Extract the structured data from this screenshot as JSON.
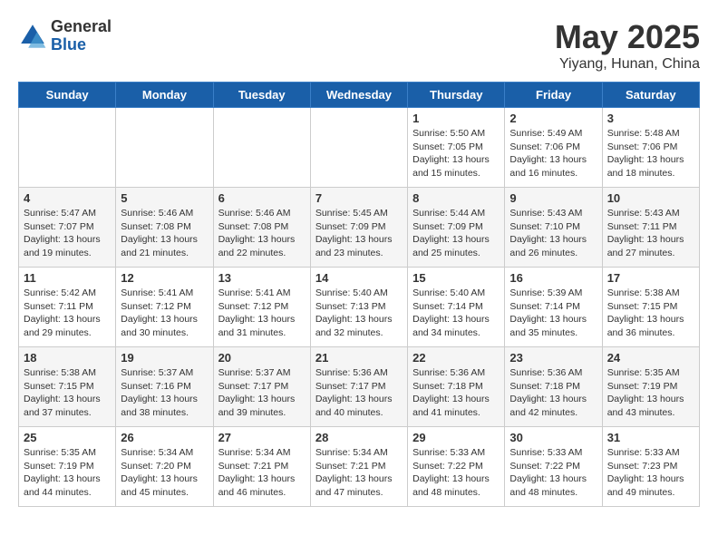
{
  "logo": {
    "general": "General",
    "blue": "Blue"
  },
  "title": "May 2025",
  "location": "Yiyang, Hunan, China",
  "days_of_week": [
    "Sunday",
    "Monday",
    "Tuesday",
    "Wednesday",
    "Thursday",
    "Friday",
    "Saturday"
  ],
  "weeks": [
    [
      {
        "day": "",
        "info": ""
      },
      {
        "day": "",
        "info": ""
      },
      {
        "day": "",
        "info": ""
      },
      {
        "day": "",
        "info": ""
      },
      {
        "day": "1",
        "info": "Sunrise: 5:50 AM\nSunset: 7:05 PM\nDaylight: 13 hours\nand 15 minutes."
      },
      {
        "day": "2",
        "info": "Sunrise: 5:49 AM\nSunset: 7:06 PM\nDaylight: 13 hours\nand 16 minutes."
      },
      {
        "day": "3",
        "info": "Sunrise: 5:48 AM\nSunset: 7:06 PM\nDaylight: 13 hours\nand 18 minutes."
      }
    ],
    [
      {
        "day": "4",
        "info": "Sunrise: 5:47 AM\nSunset: 7:07 PM\nDaylight: 13 hours\nand 19 minutes."
      },
      {
        "day": "5",
        "info": "Sunrise: 5:46 AM\nSunset: 7:08 PM\nDaylight: 13 hours\nand 21 minutes."
      },
      {
        "day": "6",
        "info": "Sunrise: 5:46 AM\nSunset: 7:08 PM\nDaylight: 13 hours\nand 22 minutes."
      },
      {
        "day": "7",
        "info": "Sunrise: 5:45 AM\nSunset: 7:09 PM\nDaylight: 13 hours\nand 23 minutes."
      },
      {
        "day": "8",
        "info": "Sunrise: 5:44 AM\nSunset: 7:09 PM\nDaylight: 13 hours\nand 25 minutes."
      },
      {
        "day": "9",
        "info": "Sunrise: 5:43 AM\nSunset: 7:10 PM\nDaylight: 13 hours\nand 26 minutes."
      },
      {
        "day": "10",
        "info": "Sunrise: 5:43 AM\nSunset: 7:11 PM\nDaylight: 13 hours\nand 27 minutes."
      }
    ],
    [
      {
        "day": "11",
        "info": "Sunrise: 5:42 AM\nSunset: 7:11 PM\nDaylight: 13 hours\nand 29 minutes."
      },
      {
        "day": "12",
        "info": "Sunrise: 5:41 AM\nSunset: 7:12 PM\nDaylight: 13 hours\nand 30 minutes."
      },
      {
        "day": "13",
        "info": "Sunrise: 5:41 AM\nSunset: 7:12 PM\nDaylight: 13 hours\nand 31 minutes."
      },
      {
        "day": "14",
        "info": "Sunrise: 5:40 AM\nSunset: 7:13 PM\nDaylight: 13 hours\nand 32 minutes."
      },
      {
        "day": "15",
        "info": "Sunrise: 5:40 AM\nSunset: 7:14 PM\nDaylight: 13 hours\nand 34 minutes."
      },
      {
        "day": "16",
        "info": "Sunrise: 5:39 AM\nSunset: 7:14 PM\nDaylight: 13 hours\nand 35 minutes."
      },
      {
        "day": "17",
        "info": "Sunrise: 5:38 AM\nSunset: 7:15 PM\nDaylight: 13 hours\nand 36 minutes."
      }
    ],
    [
      {
        "day": "18",
        "info": "Sunrise: 5:38 AM\nSunset: 7:15 PM\nDaylight: 13 hours\nand 37 minutes."
      },
      {
        "day": "19",
        "info": "Sunrise: 5:37 AM\nSunset: 7:16 PM\nDaylight: 13 hours\nand 38 minutes."
      },
      {
        "day": "20",
        "info": "Sunrise: 5:37 AM\nSunset: 7:17 PM\nDaylight: 13 hours\nand 39 minutes."
      },
      {
        "day": "21",
        "info": "Sunrise: 5:36 AM\nSunset: 7:17 PM\nDaylight: 13 hours\nand 40 minutes."
      },
      {
        "day": "22",
        "info": "Sunrise: 5:36 AM\nSunset: 7:18 PM\nDaylight: 13 hours\nand 41 minutes."
      },
      {
        "day": "23",
        "info": "Sunrise: 5:36 AM\nSunset: 7:18 PM\nDaylight: 13 hours\nand 42 minutes."
      },
      {
        "day": "24",
        "info": "Sunrise: 5:35 AM\nSunset: 7:19 PM\nDaylight: 13 hours\nand 43 minutes."
      }
    ],
    [
      {
        "day": "25",
        "info": "Sunrise: 5:35 AM\nSunset: 7:19 PM\nDaylight: 13 hours\nand 44 minutes."
      },
      {
        "day": "26",
        "info": "Sunrise: 5:34 AM\nSunset: 7:20 PM\nDaylight: 13 hours\nand 45 minutes."
      },
      {
        "day": "27",
        "info": "Sunrise: 5:34 AM\nSunset: 7:21 PM\nDaylight: 13 hours\nand 46 minutes."
      },
      {
        "day": "28",
        "info": "Sunrise: 5:34 AM\nSunset: 7:21 PM\nDaylight: 13 hours\nand 47 minutes."
      },
      {
        "day": "29",
        "info": "Sunrise: 5:33 AM\nSunset: 7:22 PM\nDaylight: 13 hours\nand 48 minutes."
      },
      {
        "day": "30",
        "info": "Sunrise: 5:33 AM\nSunset: 7:22 PM\nDaylight: 13 hours\nand 48 minutes."
      },
      {
        "day": "31",
        "info": "Sunrise: 5:33 AM\nSunset: 7:23 PM\nDaylight: 13 hours\nand 49 minutes."
      }
    ]
  ]
}
